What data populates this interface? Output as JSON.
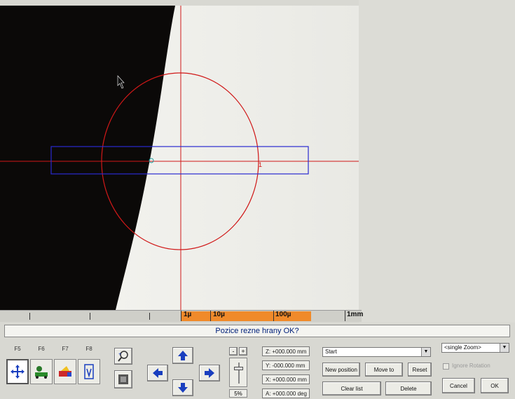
{
  "status": {
    "message": "Pozice rezne hrany OK?"
  },
  "scale": {
    "labels": [
      "1µ",
      "10µ",
      "100µ",
      "1mm"
    ]
  },
  "overlay": {
    "marker_label": "1"
  },
  "function_keys": [
    "F5",
    "F6",
    "F7",
    "F8"
  ],
  "tools": [
    "move-tool",
    "part-tool",
    "light-tool",
    "fixture-tool",
    "zoom-tool",
    "capture-tool"
  ],
  "zoom": {
    "minus": "-",
    "plus": "+",
    "percent": "5%"
  },
  "readouts": {
    "z": "Z: +000.000 mm",
    "y": "Y: -000.000 mm",
    "x": "X: +000.000 mm",
    "a": "A: +000.000 deg"
  },
  "positions": {
    "selected": "Start",
    "new_position": "New position",
    "move_to": "Move to",
    "reset": "Reset",
    "clear_list": "Clear list",
    "delete": "Delete"
  },
  "zoom_mode": {
    "selected": "<single Zoom>",
    "checkbox_label": "Ignore Rotation"
  },
  "dialog": {
    "cancel": "Cancel",
    "ok": "OK"
  },
  "colors": {
    "crosshair": "#d01818",
    "roi": "#2a2ad0",
    "scale_highlight": "#f08a2a",
    "status_text": "#00207a"
  }
}
